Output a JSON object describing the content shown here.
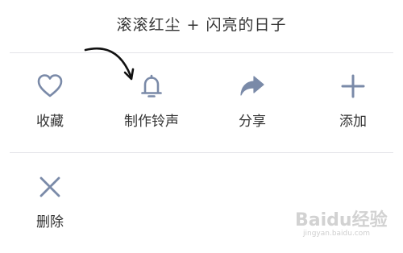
{
  "title": "滚滚红尘 + 闪亮的日子",
  "actions": [
    {
      "label": "收藏",
      "icon": "heart-icon"
    },
    {
      "label": "制作铃声",
      "icon": "bell-icon"
    },
    {
      "label": "分享",
      "icon": "share-icon"
    },
    {
      "label": "添加",
      "icon": "plus-icon"
    },
    {
      "label": "删除",
      "icon": "close-icon"
    }
  ],
  "watermark": {
    "brand": "Baidu经验",
    "url": "jingyan.baidu.com"
  },
  "colors": {
    "icon": "#7a8aa8",
    "text": "#333333",
    "divider": "#e3e3e8",
    "watermark": "#d0d0d0"
  }
}
